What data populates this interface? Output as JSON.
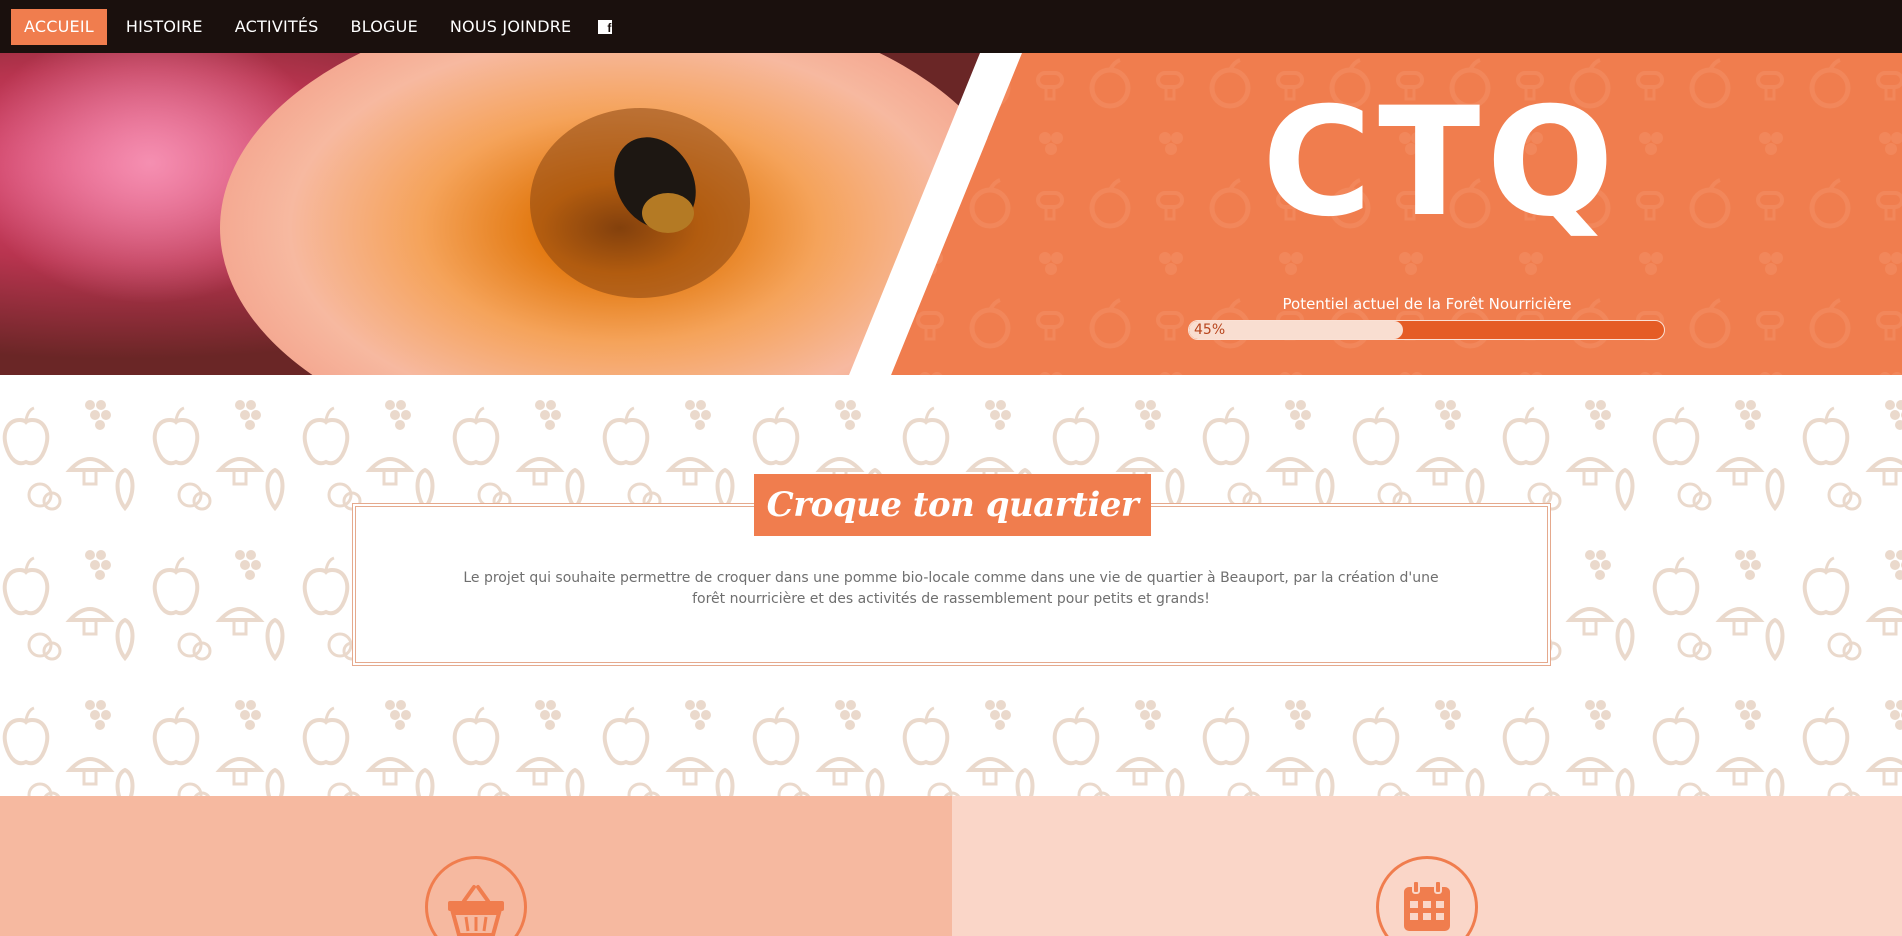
{
  "nav": {
    "items": [
      {
        "label": "ACCUEIL",
        "active": true
      },
      {
        "label": "HISTOIRE",
        "active": false
      },
      {
        "label": "ACTIVITÉS",
        "active": false
      },
      {
        "label": "BLOGUE",
        "active": false
      },
      {
        "label": "NOUS JOINDRE",
        "active": false
      }
    ],
    "social_icon": "facebook-icon",
    "social_glyph": "f"
  },
  "hero": {
    "logo_text": "CTQ",
    "progress_label": "Potentiel actuel de la Forêt Nourricière",
    "progress_value": 45,
    "progress_text": "45%"
  },
  "intro": {
    "title": "Croque ton quartier",
    "text": "Le projet qui souhaite permettre de croquer dans une pomme bio-locale comme dans une vie de quartier à Beauport, par la création d'une forêt nourricière et des activités de rassemblement pour petits et grands!"
  },
  "panels": [
    {
      "icon": "basket-icon"
    },
    {
      "icon": "calendar-icon"
    }
  ],
  "colors": {
    "accent": "#f07d4e",
    "nav_bg": "#1a100d",
    "panel_left": "#f6b9a0",
    "panel_right": "#fad6c8",
    "pattern": "#ead9cc"
  }
}
